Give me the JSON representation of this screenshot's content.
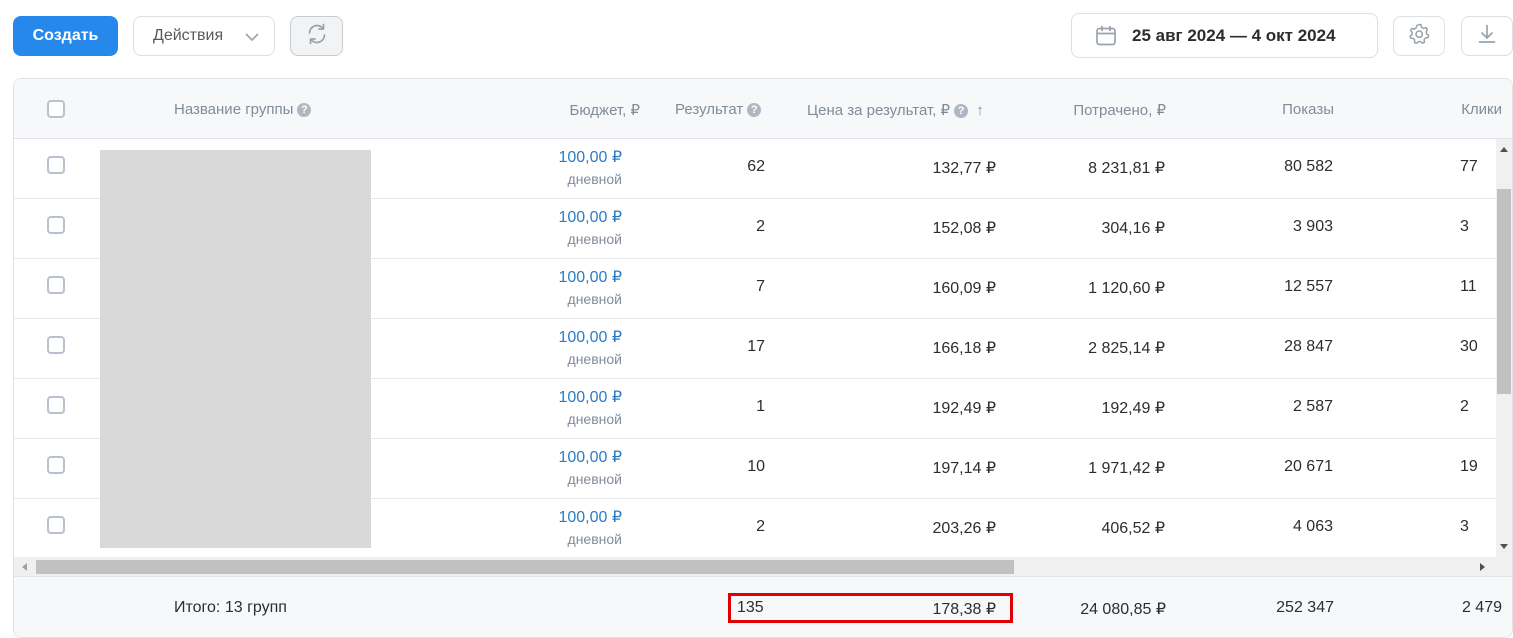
{
  "toolbar": {
    "create_label": "Создать",
    "actions_label": "Действия",
    "date_range": "25 авг 2024 — 4 окт 2024"
  },
  "icons": {
    "refresh": "refresh-icon",
    "calendar": "calendar-icon",
    "settings": "gear-icon",
    "download": "download-icon"
  },
  "colors": {
    "primary": "#2688eb",
    "link": "#2a7dc5",
    "highlight": "#e00000"
  },
  "table": {
    "headers": {
      "name": "Название группы",
      "budget": "Бюджет, ₽",
      "result": "Результат",
      "cost_per_result": "Цена за результат, ₽",
      "sort_indicator": "↑",
      "spent": "Потрачено, ₽",
      "impressions": "Показы",
      "clicks": "Клики"
    },
    "rows": [
      {
        "budget": "100,00 ₽",
        "budget_type": "дневной",
        "result": "62",
        "cost": "132,77 ₽",
        "spent": "8 231,81 ₽",
        "impressions": "80 582",
        "clicks": "77"
      },
      {
        "budget": "100,00 ₽",
        "budget_type": "дневной",
        "result": "2",
        "cost": "152,08 ₽",
        "spent": "304,16 ₽",
        "impressions": "3 903",
        "clicks": "3"
      },
      {
        "budget": "100,00 ₽",
        "budget_type": "дневной",
        "result": "7",
        "cost": "160,09 ₽",
        "spent": "1 120,60 ₽",
        "impressions": "12 557",
        "clicks": "11"
      },
      {
        "budget": "100,00 ₽",
        "budget_type": "дневной",
        "result": "17",
        "cost": "166,18 ₽",
        "spent": "2 825,14 ₽",
        "impressions": "28 847",
        "clicks": "30"
      },
      {
        "budget": "100,00 ₽",
        "budget_type": "дневной",
        "result": "1",
        "cost": "192,49 ₽",
        "spent": "192,49 ₽",
        "impressions": "2 587",
        "clicks": "2"
      },
      {
        "budget": "100,00 ₽",
        "budget_type": "дневной",
        "result": "10",
        "cost": "197,14 ₽",
        "spent": "1 971,42 ₽",
        "impressions": "20 671",
        "clicks": "19"
      },
      {
        "budget": "100,00 ₽",
        "budget_type": "дневной",
        "result": "2",
        "cost": "203,26 ₽",
        "spent": "406,52 ₽",
        "impressions": "4 063",
        "clicks": "3"
      }
    ],
    "total": {
      "label": "Итого: 13 групп",
      "result": "135",
      "cost": "178,38 ₽",
      "spent": "24 080,85 ₽",
      "impressions": "252 347",
      "clicks": "2 479"
    }
  }
}
